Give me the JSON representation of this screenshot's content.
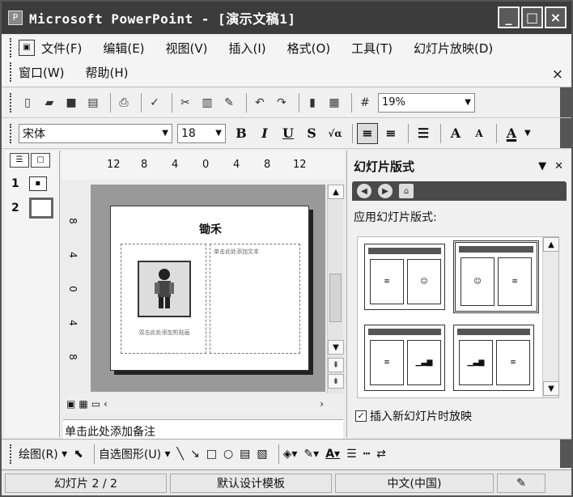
{
  "window": {
    "title": "Microsoft PowerPoint - [演示文稿1]",
    "buttons": [
      "_",
      "□",
      "×"
    ]
  },
  "menu": {
    "row1": [
      "文件(F)",
      "编辑(E)",
      "视图(V)",
      "插入(I)",
      "格式(O)",
      "工具(T)",
      "幻灯片放映(D)"
    ],
    "row2": [
      "窗口(W)",
      "帮助(H)"
    ],
    "close": "×"
  },
  "toolbar": {
    "zoom": "19%"
  },
  "format": {
    "font": "宋体",
    "size": "18",
    "bold": "B",
    "italic": "I",
    "underline": "U",
    "shadow": "S",
    "font_grow": "A",
    "font_shrink": "A",
    "font_color": "A"
  },
  "thumbs": [
    {
      "num": "1"
    },
    {
      "num": "2"
    }
  ],
  "rulers": {
    "top": [
      "12",
      "8",
      "4",
      "0",
      "4",
      "8",
      "12"
    ],
    "left": [
      "8",
      "4",
      "0",
      "4",
      "8"
    ]
  },
  "slide": {
    "title": "锄禾",
    "left_caption": "双击此处添加剪贴画",
    "right_caption": "单击此处添加文本"
  },
  "notes": "单击此处添加备注",
  "taskpane": {
    "title": "幻灯片版式",
    "label": "应用幻灯片版式:",
    "checkbox": "插入新幻灯片时放映",
    "checked": true
  },
  "drawbar": {
    "draw": "绘图(R)",
    "autoshapes": "自选图形(U)"
  },
  "status": {
    "slide": "幻灯片 2 / 2",
    "template": "默认设计模板",
    "lang": "中文(中国)"
  }
}
